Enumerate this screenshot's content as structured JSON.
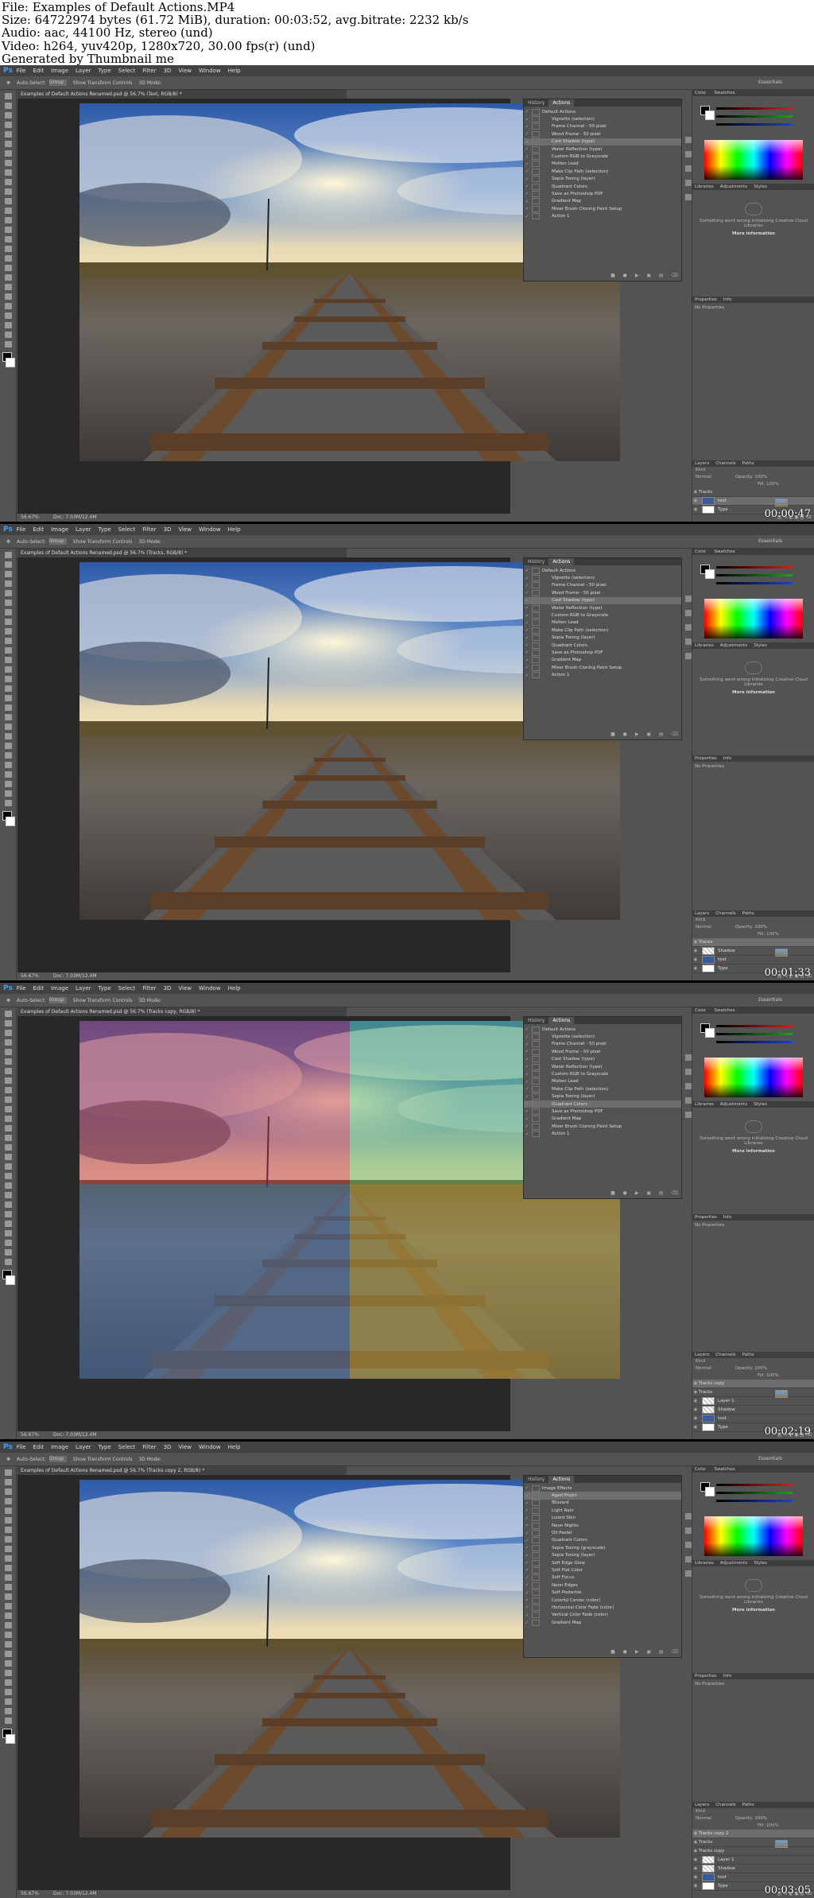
{
  "info": {
    "lines": [
      "File: Examples of Default Actions.MP4",
      "Size: 64722974 bytes (61.72 MiB), duration: 00:03:52, avg.bitrate: 2232 kb/s",
      "Audio: aac, 44100 Hz, stereo (und)",
      "Video: h264, yuv420p, 1280x720, 30.00 fps(r) (und)",
      "Generated by Thumbnail me"
    ]
  },
  "app": {
    "logo": "Ps",
    "menu": [
      "File",
      "Edit",
      "Image",
      "Layer",
      "Type",
      "Select",
      "Filter",
      "3D",
      "View",
      "Window",
      "Help"
    ],
    "options": {
      "auto_select": "Auto-Select:",
      "group": "Group",
      "transform": "Show Transform Controls",
      "mode_3d": "3D Mode:",
      "workspace": "Essentials"
    },
    "panel_tabs": {
      "history": "History",
      "actions": "Actions",
      "color": "Color",
      "swatches": "Swatches",
      "libraries": "Libraries",
      "adjustments": "Adjustments",
      "styles": "Styles",
      "properties": "Properties",
      "info": "Info",
      "layers": "Layers",
      "channels": "Channels",
      "paths": "Paths"
    },
    "libraries_msg": "Something went wrong initializing Creative Cloud Libraries",
    "more_info": "More information",
    "no_properties": "No Properties",
    "layer_kind": "Kind",
    "layer_mode": "Normal",
    "opacity": "Opacity: 100%",
    "fill": "Fill: 100%",
    "zoom": "56.67%",
    "doc": "Doc: 7.03M/12.4M"
  },
  "default_actions": [
    "Default Actions",
    "Vignette (selection)",
    "Frame Channel - 50 pixel",
    "Wood Frame - 50 pixel",
    "Cast Shadow (type)",
    "Water Reflection (type)",
    "Custom RGB to Grayscale",
    "Molten Lead",
    "Make Clip Path (selection)",
    "Sepia Toning (layer)",
    "Quadrant Colors",
    "Save as Photoshop PDF",
    "Gradient Map",
    "Mixer Brush Cloning Paint Setup",
    "Action 1"
  ],
  "image_effects": [
    "Image Effects",
    "Aged Photo",
    "Blizzard",
    "Light Rain",
    "Lizard Skin",
    "Neon Nights",
    "Oil Pastel",
    "Quadrant Colors",
    "Sepia Toning (grayscale)",
    "Sepia Toning (layer)",
    "Soft Edge Glow",
    "Soft Flat Color",
    "Soft Focus",
    "Neon Edges",
    "Soft Posterize",
    "Colorful Center (color)",
    "Horizontal Color Fade (color)",
    "Vertical Color Fade (color)",
    "Gradient Map"
  ],
  "frames": [
    {
      "doctab": "Examples of Default Actions Renamed.psd @ 56.7% (Text, RGB/8) *",
      "timestamp": "00:00:47",
      "list": "default",
      "selected": 4,
      "layers": [
        {
          "name": "Tracks",
          "thumb": "photo",
          "sel": false
        },
        {
          "name": "text",
          "thumb": "blue",
          "sel": true
        },
        {
          "name": "Type",
          "thumb": "white",
          "sel": false
        }
      ]
    },
    {
      "doctab": "Examples of Default Actions Renamed.psd @ 56.7% (Tracks, RGB/8) *",
      "timestamp": "00:01:33",
      "list": "default",
      "selected": 4,
      "layers": [
        {
          "name": "Tracks",
          "thumb": "photo",
          "sel": true
        },
        {
          "name": "Shadow",
          "thumb": "checker",
          "sel": false
        },
        {
          "name": "text",
          "thumb": "blue",
          "sel": false
        },
        {
          "name": "Type",
          "thumb": "white",
          "sel": false
        }
      ]
    },
    {
      "doctab": "Examples of Default Actions Renamed.psd @ 56.7% (Tracks copy, RGB/8) *",
      "timestamp": "00:02:19",
      "list": "default",
      "selected": 10,
      "layers": [
        {
          "name": "Tracks copy",
          "thumb": "photo",
          "sel": true
        },
        {
          "name": "Tracks",
          "thumb": "photo",
          "sel": false
        },
        {
          "name": "Layer 1",
          "thumb": "checker",
          "sel": false
        },
        {
          "name": "Shadow",
          "thumb": "checker",
          "sel": false
        },
        {
          "name": "text",
          "thumb": "blue",
          "sel": false
        },
        {
          "name": "Type",
          "thumb": "white",
          "sel": false
        }
      ]
    },
    {
      "doctab": "Examples of Default Actions Renamed.psd @ 56.7% (Tracks copy 2, RGB/8) *",
      "timestamp": "00:03:05",
      "list": "effects",
      "selected": 1,
      "layers": [
        {
          "name": "Tracks copy 2",
          "thumb": "photo",
          "sel": true
        },
        {
          "name": "Tracks",
          "thumb": "photo",
          "sel": false
        },
        {
          "name": "Tracks copy",
          "thumb": "photo",
          "sel": false
        },
        {
          "name": "Layer 1",
          "thumb": "checker",
          "sel": false
        },
        {
          "name": "Shadow",
          "thumb": "checker",
          "sel": false
        },
        {
          "name": "text",
          "thumb": "blue",
          "sel": false
        },
        {
          "name": "Type",
          "thumb": "white",
          "sel": false
        }
      ]
    }
  ],
  "colors": {
    "accent": "#39a0ff",
    "ui_bg": "#535353",
    "panel_dark": "#424242",
    "pasteboard": "#282828"
  },
  "icons": {
    "check": "✓",
    "eye": "👁"
  }
}
